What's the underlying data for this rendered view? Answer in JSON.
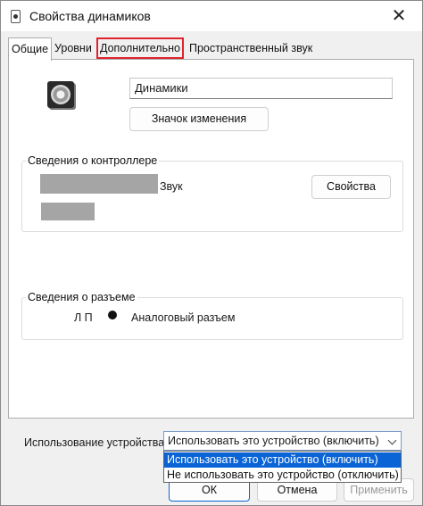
{
  "window": {
    "title": "Свойства динамиков",
    "close_glyph": "✕"
  },
  "tabs": [
    {
      "label": "Общие",
      "active": true
    },
    {
      "label": "Уровни"
    },
    {
      "label": "Дополнительно",
      "highlighted": true
    },
    {
      "label": "Пространственный звук"
    }
  ],
  "device": {
    "icon": "speaker-icon",
    "name_value": "Динамики"
  },
  "buttons": {
    "change_icon": "Значок изменения",
    "properties": "Свойства",
    "ok": "ОК",
    "cancel": "Отмена",
    "apply": "Применить"
  },
  "controller": {
    "legend": "Сведения о контроллере",
    "sound_label": "Звук"
  },
  "jack": {
    "legend": "Сведения о разъеме",
    "lp": "Л П",
    "text": "Аналоговый разъем"
  },
  "usage": {
    "label": "Использование устройства:",
    "selected": "Использовать это устройство (включить)",
    "options": [
      "Использовать это устройство (включить)",
      "Не использовать это устройство (отключить)"
    ]
  },
  "colors": {
    "highlight": "#e0232f",
    "selection": "#0a64d6"
  }
}
